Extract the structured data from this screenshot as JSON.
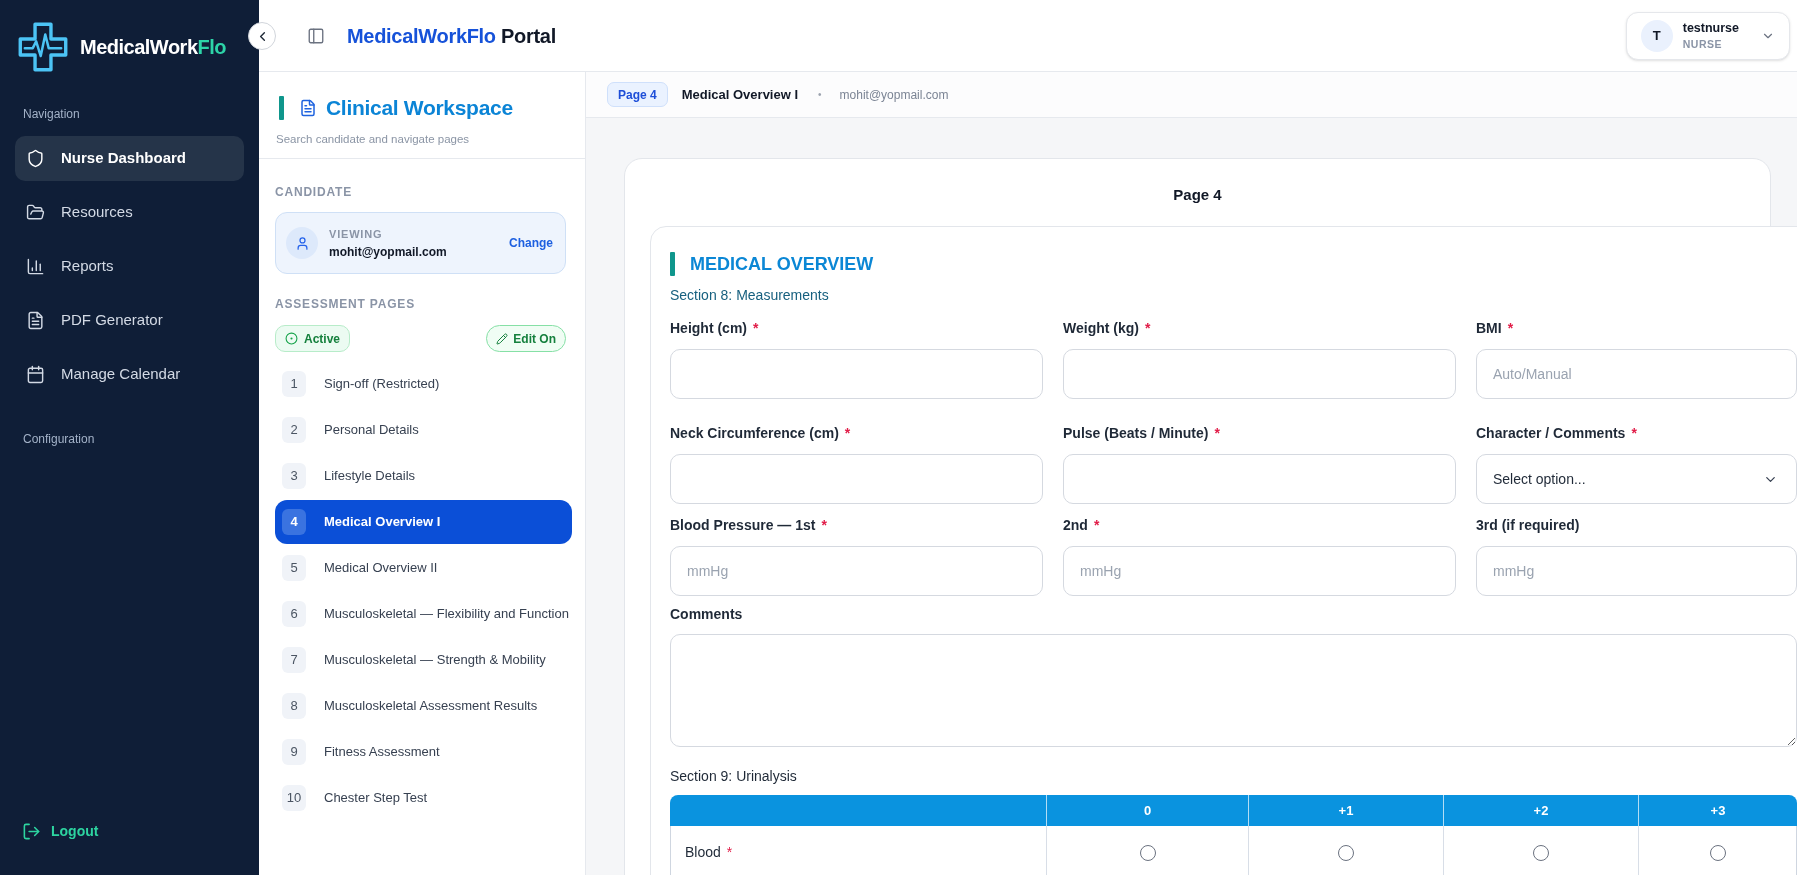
{
  "sidebar": {
    "logo": {
      "text": "MedicalWork",
      "accent": "Flo"
    },
    "nav_heading": "Navigation",
    "items": [
      {
        "label": "Nurse Dashboard",
        "selected": true
      },
      {
        "label": "Resources",
        "selected": false
      },
      {
        "label": "Reports",
        "selected": false
      },
      {
        "label": "PDF Generator",
        "selected": false
      },
      {
        "label": "Manage Calendar",
        "selected": false
      }
    ],
    "config_heading": "Configuration",
    "logout": "Logout"
  },
  "header": {
    "brand": "MedicalWorkFlo",
    "title": "Portal",
    "user": {
      "initial": "T",
      "name": "testnurse",
      "role": "NURSE"
    }
  },
  "workspace": {
    "title": "Clinical Workspace",
    "subtitle": "Search candidate and navigate pages",
    "candidate_heading": "CANDIDATE",
    "candidate": {
      "status": "VIEWING",
      "email": "mohit@yopmail.com",
      "action": "Change"
    },
    "pages_heading": "ASSESSMENT PAGES",
    "status_badge": "Active",
    "edit_toggle": "Edit On",
    "pages": [
      {
        "number": "1",
        "label": "Sign-off (Restricted)",
        "selected": false
      },
      {
        "number": "2",
        "label": "Personal Details",
        "selected": false
      },
      {
        "number": "3",
        "label": "Lifestyle Details",
        "selected": false
      },
      {
        "number": "4",
        "label": "Medical Overview I",
        "selected": true
      },
      {
        "number": "5",
        "label": "Medical Overview II",
        "selected": false
      },
      {
        "number": "6",
        "label": "Musculoskeletal — Flexibility and Function",
        "selected": false
      },
      {
        "number": "7",
        "label": "Musculoskeletal — Strength & Mobility",
        "selected": false
      },
      {
        "number": "8",
        "label": "Musculoskeletal Assessment Results",
        "selected": false
      },
      {
        "number": "9",
        "label": "Fitness Assessment",
        "selected": false
      },
      {
        "number": "10",
        "label": "Chester Step Test",
        "selected": false
      }
    ]
  },
  "breadcrumb": {
    "page": "Page 4",
    "title": "Medical Overview I",
    "separator": "•",
    "email": "mohit@yopmail.com"
  },
  "form": {
    "page_title": "Page 4",
    "heading": "MEDICAL OVERVIEW",
    "section_8": {
      "title": "Section 8: Measurements",
      "rows": [
        [
          {
            "kind": "input",
            "label": "Height (cm)",
            "mark": "*"
          },
          {
            "kind": "input",
            "label": "Weight (kg)",
            "mark": "*"
          },
          {
            "kind": "input",
            "label": "BMI",
            "mark": "*",
            "placeholder": "Auto/Manual"
          }
        ],
        [
          {
            "kind": "input",
            "label": "Neck Circumference (cm)",
            "mark": "*"
          },
          {
            "kind": "input",
            "label": "Pulse (Beats / Minute)",
            "mark": "*"
          },
          {
            "kind": "select",
            "label": "Character / Comments",
            "mark": "*",
            "placeholder": "Select option..."
          }
        ],
        [
          {
            "kind": "input",
            "label": "Blood Pressure — 1st",
            "mark": "*",
            "placeholder": "mmHg"
          },
          {
            "kind": "input",
            "label": "2nd",
            "mark": "*",
            "placeholder": "mmHg"
          },
          {
            "kind": "input",
            "label": "3rd (if required)",
            "placeholder": "mmHg"
          }
        ]
      ],
      "comments": {
        "label": "Comments"
      }
    },
    "section_9": {
      "title": "Section 9: Urinalysis",
      "columns": [
        "0",
        "+1",
        "+2",
        "+3"
      ],
      "rows": [
        {
          "label": "Blood",
          "mark": "*",
          "options": [
            {
              "selected": false
            },
            {
              "selected": false
            },
            {
              "selected": false
            },
            {
              "selected": false
            }
          ]
        }
      ]
    }
  }
}
